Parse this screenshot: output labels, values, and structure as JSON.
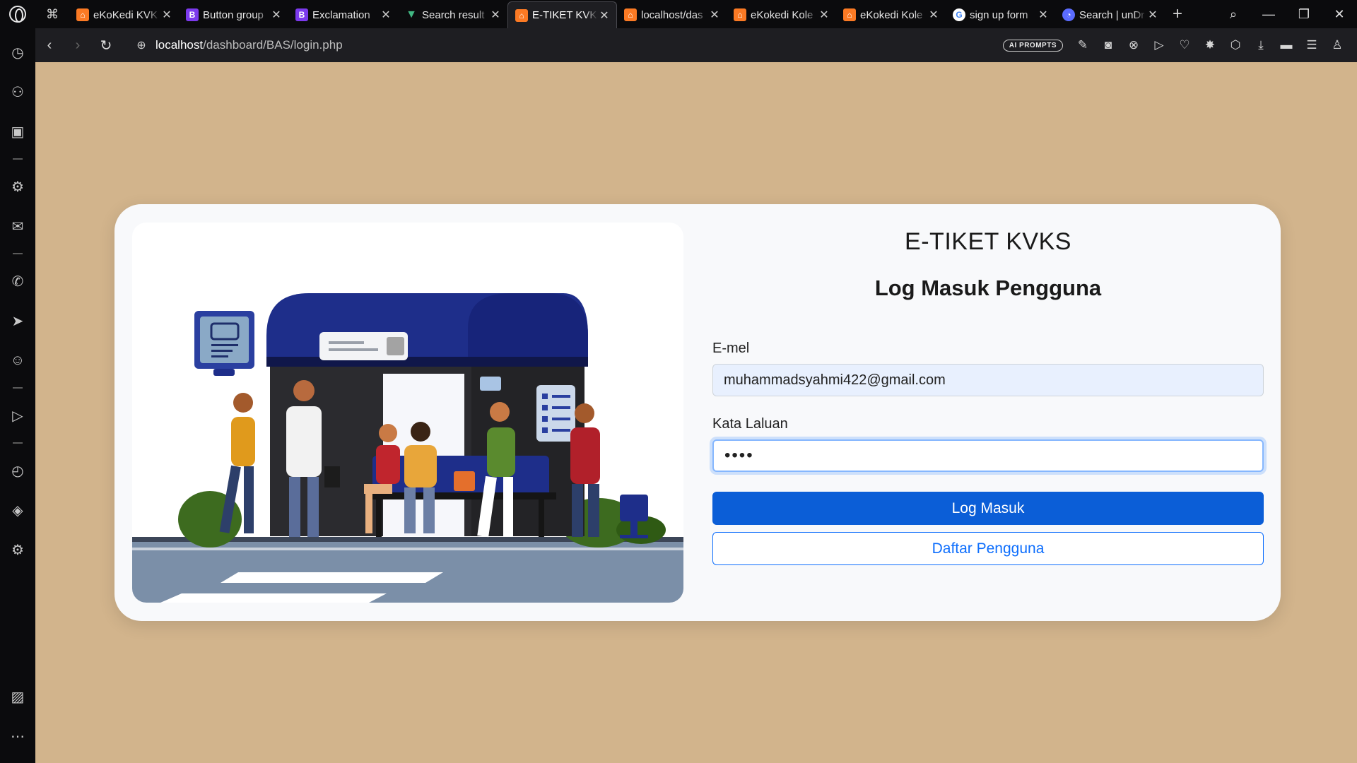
{
  "browser": {
    "tabs": [
      {
        "title": "eKoKedi KVK",
        "icon": "xampp-icon",
        "active": false
      },
      {
        "title": "Button group",
        "icon": "bootstrap-icon",
        "active": false
      },
      {
        "title": "Exclamation",
        "icon": "bootstrap-icon",
        "active": false
      },
      {
        "title": "Search result",
        "icon": "vue-icon",
        "active": false
      },
      {
        "title": "E-TIKET KVKS",
        "icon": "xampp-icon",
        "active": true
      },
      {
        "title": "localhost/das",
        "icon": "xampp-icon",
        "active": false
      },
      {
        "title": "eKokedi Kole",
        "icon": "xampp-icon",
        "active": false
      },
      {
        "title": "eKokedi Kole",
        "icon": "xampp-icon",
        "active": false
      },
      {
        "title": "sign up form",
        "icon": "google-icon",
        "active": false
      },
      {
        "title": "Search | unDr",
        "icon": "undraw-icon",
        "active": false
      }
    ],
    "url_host": "localhost",
    "url_path": "/dashboard/BAS/login.php",
    "ai_prompts_label": "AI PROMPTS"
  },
  "page": {
    "app_title": "E-TIKET KVKS",
    "form_title": "Log Masuk Pengguna",
    "email_label": "E-mel",
    "email_value": "muhammadsyahmi422@gmail.com",
    "password_label": "Kata Laluan",
    "password_value": "••••",
    "login_button": "Log Masuk",
    "register_button": "Daftar Pengguna"
  },
  "colors": {
    "page_background": "#d2b48c",
    "primary": "#0b5ed7",
    "card": "#f8f9fb"
  }
}
